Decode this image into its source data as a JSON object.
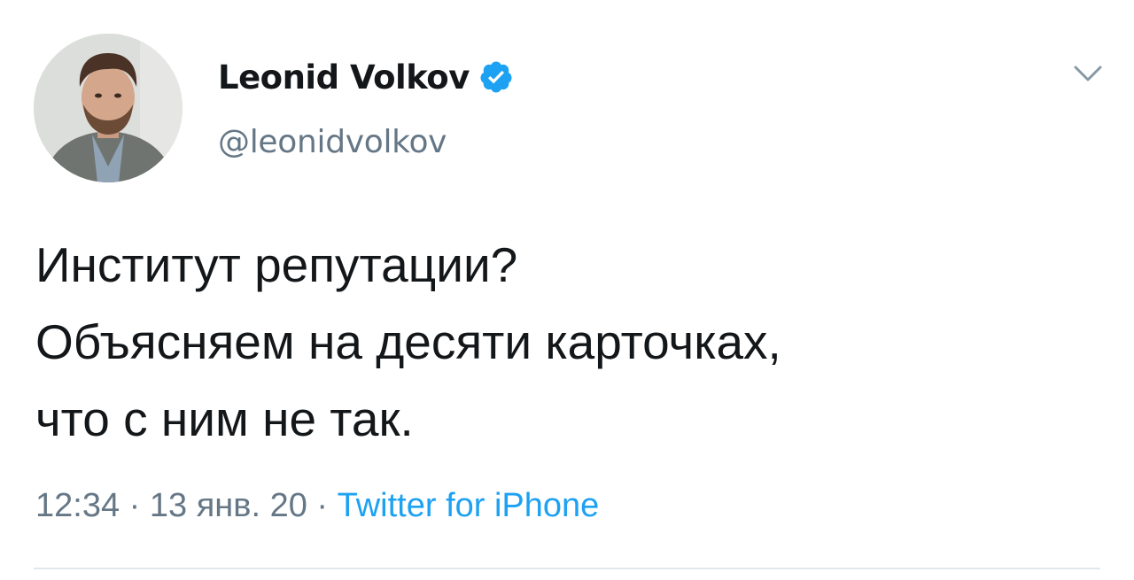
{
  "author": {
    "display_name": "Leonid Volkov",
    "handle": "@leonidvolkov",
    "verified": true
  },
  "tweet": {
    "lines": [
      "Институт репутации?",
      "Объясняем на десяти карточках,",
      "что с ним не так."
    ]
  },
  "meta": {
    "time": "12:34",
    "separator": "·",
    "date": "13 янв. 20",
    "source": "Twitter for iPhone"
  },
  "icons": {
    "verified": "verified-badge-icon",
    "menu": "chevron-down-icon"
  },
  "colors": {
    "text": "#14171a",
    "secondary": "#657786",
    "link": "#1da1f2",
    "divider": "#e1e8ed"
  }
}
